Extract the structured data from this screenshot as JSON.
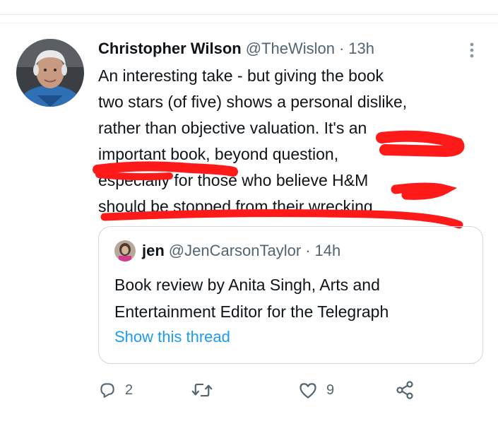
{
  "tweet": {
    "author_name": "Christopher Wilson",
    "author_handle": "@TheWislon",
    "separator": "·",
    "time": "13h",
    "text": "An interesting take - but giving the book\ntwo stars (of five) shows a personal dislike,\nrather than objective valuation. It's an\nimportant book, beyond question,\nespecially for those who believe H&M\nshould be stopped from their wrecking"
  },
  "quoted": {
    "name": "jen",
    "handle": "@JenCarsonTaylor",
    "separator": "·",
    "time": "14h",
    "text": "Book review by Anita Singh, Arts and\nEntertainment Editor for the Telegraph",
    "link": "Show this thread"
  },
  "actions": {
    "reply_count": "2",
    "retweet_count": "",
    "like_count": "9"
  },
  "colors": {
    "text": "#0f1419",
    "muted": "#536471",
    "link": "#1d9bf0",
    "border": "#cfd9de",
    "scribble": "#ff1a1a"
  },
  "icons": {
    "reply": "reply-icon",
    "retweet": "retweet-icon",
    "like": "like-icon",
    "share": "share-icon",
    "more": "more-vertical-icon"
  }
}
